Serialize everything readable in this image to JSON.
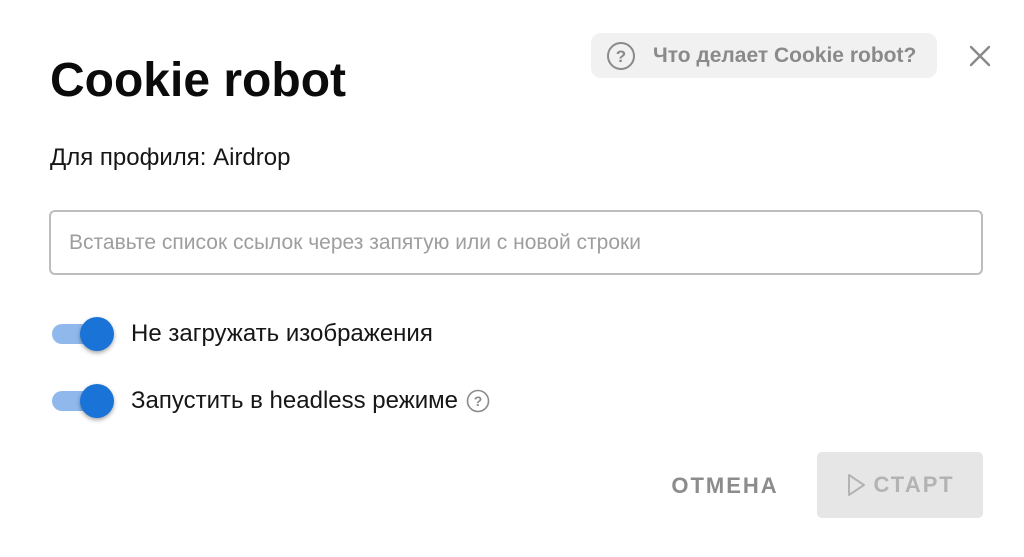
{
  "header": {
    "help_link": "Что делает Cookie robot?",
    "help_icon": "question-circle-icon",
    "close_icon": "close-icon",
    "title": "Cookie robot"
  },
  "profile": {
    "text": "Для профиля: Airdrop"
  },
  "links_input": {
    "value": "",
    "placeholder": "Вставьте список ссылок через запятую или с новой строки"
  },
  "options": [
    {
      "label": "Не загружать изображения",
      "enabled": true
    },
    {
      "label": "Запустить в headless режиме",
      "enabled": true,
      "info_icon": "question-circle-icon"
    }
  ],
  "actions": {
    "cancel_label": "ОТМЕНА",
    "start_label": "СТАРТ",
    "start_icon": "play-icon",
    "start_disabled": true
  },
  "colors": {
    "accent": "#1a73d6",
    "track": "#8fb9ec",
    "disabled_bg": "#e6e6e6",
    "disabled_text": "#b3b3b3",
    "muted_text": "#8c8c8c"
  }
}
